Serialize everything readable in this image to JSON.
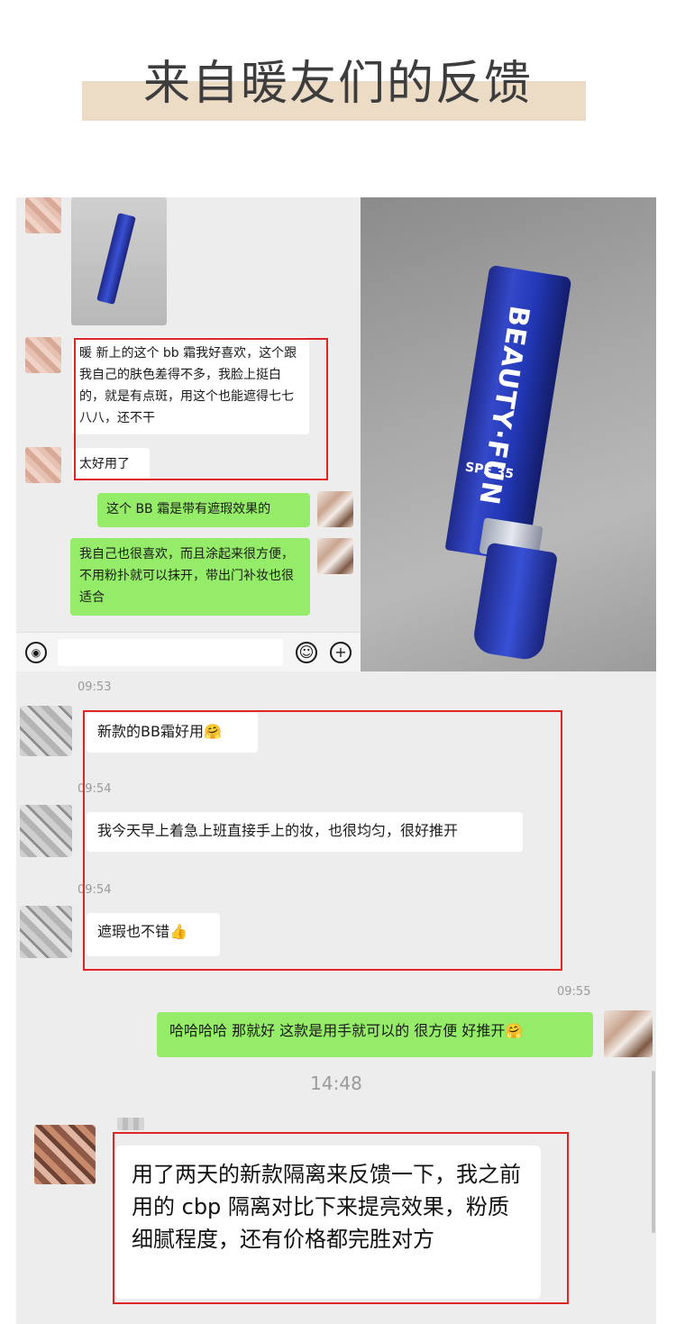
{
  "header": {
    "title": "来自暖友们的反馈"
  },
  "panel1": {
    "messages": [
      {
        "text": "暖 新上的这个 bb 霜我好喜欢，这个跟我自己的肤色差得不多，我脸上挺白的，就是有点斑，用这个也能遮得七七八八，还不干"
      },
      {
        "text": "太好用了"
      },
      {
        "text": "这个 BB 霜是带有遮瑕效果的"
      },
      {
        "text": "我自己也很喜欢，而且涂起来很方便，不用粉扑就可以抹开，带出门补妆也很适合"
      }
    ],
    "product_brand": "BEAUTY·FUN",
    "product_spf": "SPF 35",
    "toolbar_icons": {
      "voice": "voice-icon",
      "emoji": "emoji-icon",
      "plus": "plus-icon"
    },
    "icon_glyphs": {
      "voice": "◉",
      "emoji": "☺",
      "plus": "+"
    }
  },
  "panel2": {
    "timestamps": [
      "09:53",
      "09:54",
      "09:54",
      "09:55",
      "14:48"
    ],
    "messages": [
      {
        "text": "新款的BB霜好用",
        "emoji": "🤗"
      },
      {
        "text": "我今天早上着急上班直接手上的妆，也很均匀，很好推开"
      },
      {
        "text": "遮瑕也不错",
        "emoji": "👍"
      },
      {
        "text": "哈哈哈哈 那就好 这款是用手就可以的 很方便 好推开",
        "emoji": "🤗"
      },
      {
        "text": "用了两天的新款隔离来反馈一下，我之前用的 cbp 隔离对比下来提亮效果，粉质细腻程度，还有价格都完胜对方"
      }
    ]
  },
  "colors": {
    "accent_band": "#ecdcc6",
    "wechat_green": "#95ec69",
    "highlight_red": "#e02424",
    "chat_bg": "#ededed"
  }
}
